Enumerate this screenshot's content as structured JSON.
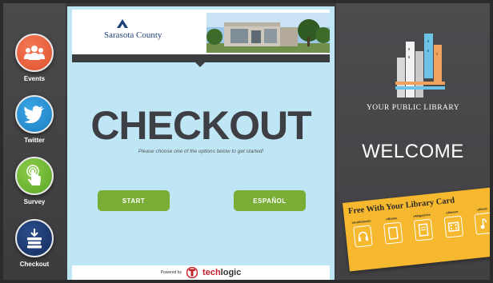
{
  "sidebar": {
    "items": [
      {
        "label": "Events",
        "icon": "people-icon",
        "color": "#e0502c"
      },
      {
        "label": "Twitter",
        "icon": "twitter-bird-icon",
        "color": "#1d7fc4"
      },
      {
        "label": "Survey",
        "icon": "touch-icon",
        "color": "#5aa524"
      },
      {
        "label": "Checkout",
        "icon": "book-stack-icon",
        "color": "#132c5c"
      }
    ]
  },
  "banner": {
    "county_name": "Sarasota County",
    "photo": "library-building-photo"
  },
  "main": {
    "title": "CHECKOUT",
    "subtitle": "Please choose one of the options below to get started!",
    "buttons": {
      "start": "START",
      "espanol": "ESPAÑOL"
    },
    "button_color": "#7aad35",
    "background_color": "#bfe6f5"
  },
  "footer": {
    "powered_by": "Powered by",
    "brand_tech": "tech",
    "brand_logic": "logic"
  },
  "right": {
    "library_name": "YOUR PUBLIC LIBRARY",
    "welcome": "WELCOME",
    "card": {
      "title": "Free With Your Library Card",
      "items": [
        "eAudiobooks",
        "eBooks",
        "eMagazines",
        "eMovies",
        "eMusic"
      ],
      "color": "#f5b82e"
    }
  }
}
